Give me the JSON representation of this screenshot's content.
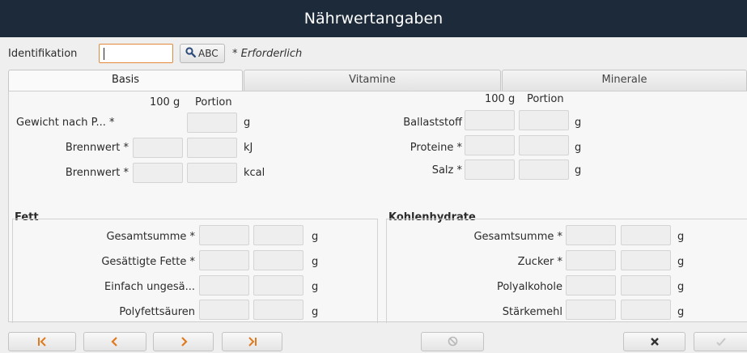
{
  "window": {
    "title": "Nährwertangaben"
  },
  "identification": {
    "label": "Identifikation",
    "value": "",
    "abc_label": "ABC",
    "required_note": "* Erforderlich"
  },
  "tabs": [
    {
      "label": "Basis",
      "active": true
    },
    {
      "label": "Vitamine",
      "active": false
    },
    {
      "label": "Minerale",
      "active": false
    }
  ],
  "basis": {
    "left_headers": {
      "per100": "100 g",
      "portion": "Portion"
    },
    "right_headers": {
      "per100": "100 g",
      "portion": "Portion"
    },
    "left_rows": [
      {
        "label": "Gewicht nach P... *",
        "unit": "g"
      },
      {
        "label": "Brennwert *",
        "unit": "kJ"
      },
      {
        "label": "Brennwert *",
        "unit": "kcal"
      }
    ],
    "right_rows": [
      {
        "label": "Ballaststoff",
        "unit": "g"
      },
      {
        "label": "Proteine *",
        "unit": "g"
      },
      {
        "label": "Salz *",
        "unit": "g"
      }
    ],
    "fett": {
      "title": "Fett",
      "rows": [
        {
          "label": "Gesamtsumme *",
          "unit": "g"
        },
        {
          "label": "Gesättigte Fette *",
          "unit": "g"
        },
        {
          "label": "Einfach ungesä...",
          "unit": "g"
        },
        {
          "label": "Polyfettsäuren",
          "unit": "g"
        }
      ]
    },
    "kohlenhydrate": {
      "title": "Kohlenhydrate",
      "rows": [
        {
          "label": "Gesamtsumme *",
          "unit": "g"
        },
        {
          "label": "Zucker *",
          "unit": "g"
        },
        {
          "label": "Polyalkohole",
          "unit": "g"
        },
        {
          "label": "Stärkemehl",
          "unit": "g"
        }
      ]
    }
  },
  "colors": {
    "titlebar": "#1c2a3a",
    "nav_arrow": "#e07a1f",
    "id_border": "#e08a3a"
  },
  "icons": {
    "search": "magnifier-icon",
    "first": "first-record-icon",
    "prev": "previous-record-icon",
    "next": "next-record-icon",
    "last": "last-record-icon",
    "cancel": "cancel-icon",
    "delete": "delete-icon",
    "ok": "checkmark-icon"
  }
}
